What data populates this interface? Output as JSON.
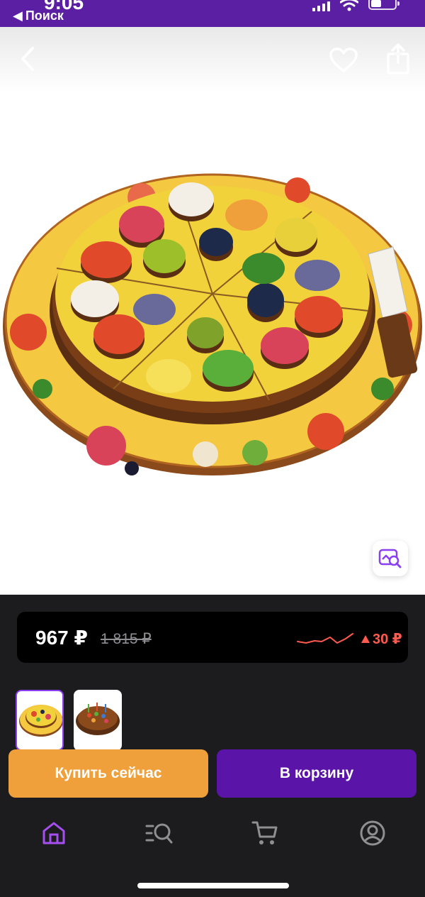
{
  "status_bar": {
    "time": "9:05",
    "back_app_label": "Поиск"
  },
  "nav": {
    "back_icon": "chevron-left-icon",
    "favorite_icon": "heart-icon",
    "share_icon": "share-icon"
  },
  "product": {
    "image_description_icon": "pizza-puzzle-image",
    "search_by_image_icon": "image-search-icon"
  },
  "price": {
    "current": "967 ₽",
    "old": "1 815 ₽",
    "delta": "30 ₽",
    "delta_direction": "up",
    "delta_color": "#ff5a4f"
  },
  "thumbnails": [
    {
      "name": "pizza-puzzle-thumbnail",
      "active": true
    },
    {
      "name": "cake-puzzle-thumbnail",
      "active": false
    }
  ],
  "actions": {
    "buy_now_label": "Купить сейчас",
    "add_to_cart_label": "В корзину",
    "buy_color": "#f0a03a",
    "cart_color": "#5b14a8"
  },
  "tab_bar": {
    "tabs": [
      {
        "name": "home",
        "icon": "home-icon",
        "active": true
      },
      {
        "name": "catalog",
        "icon": "catalog-search-icon",
        "active": false
      },
      {
        "name": "cart",
        "icon": "cart-icon",
        "active": false
      },
      {
        "name": "profile",
        "icon": "profile-icon",
        "active": false
      }
    ],
    "accent_color": "#a64ff0"
  }
}
